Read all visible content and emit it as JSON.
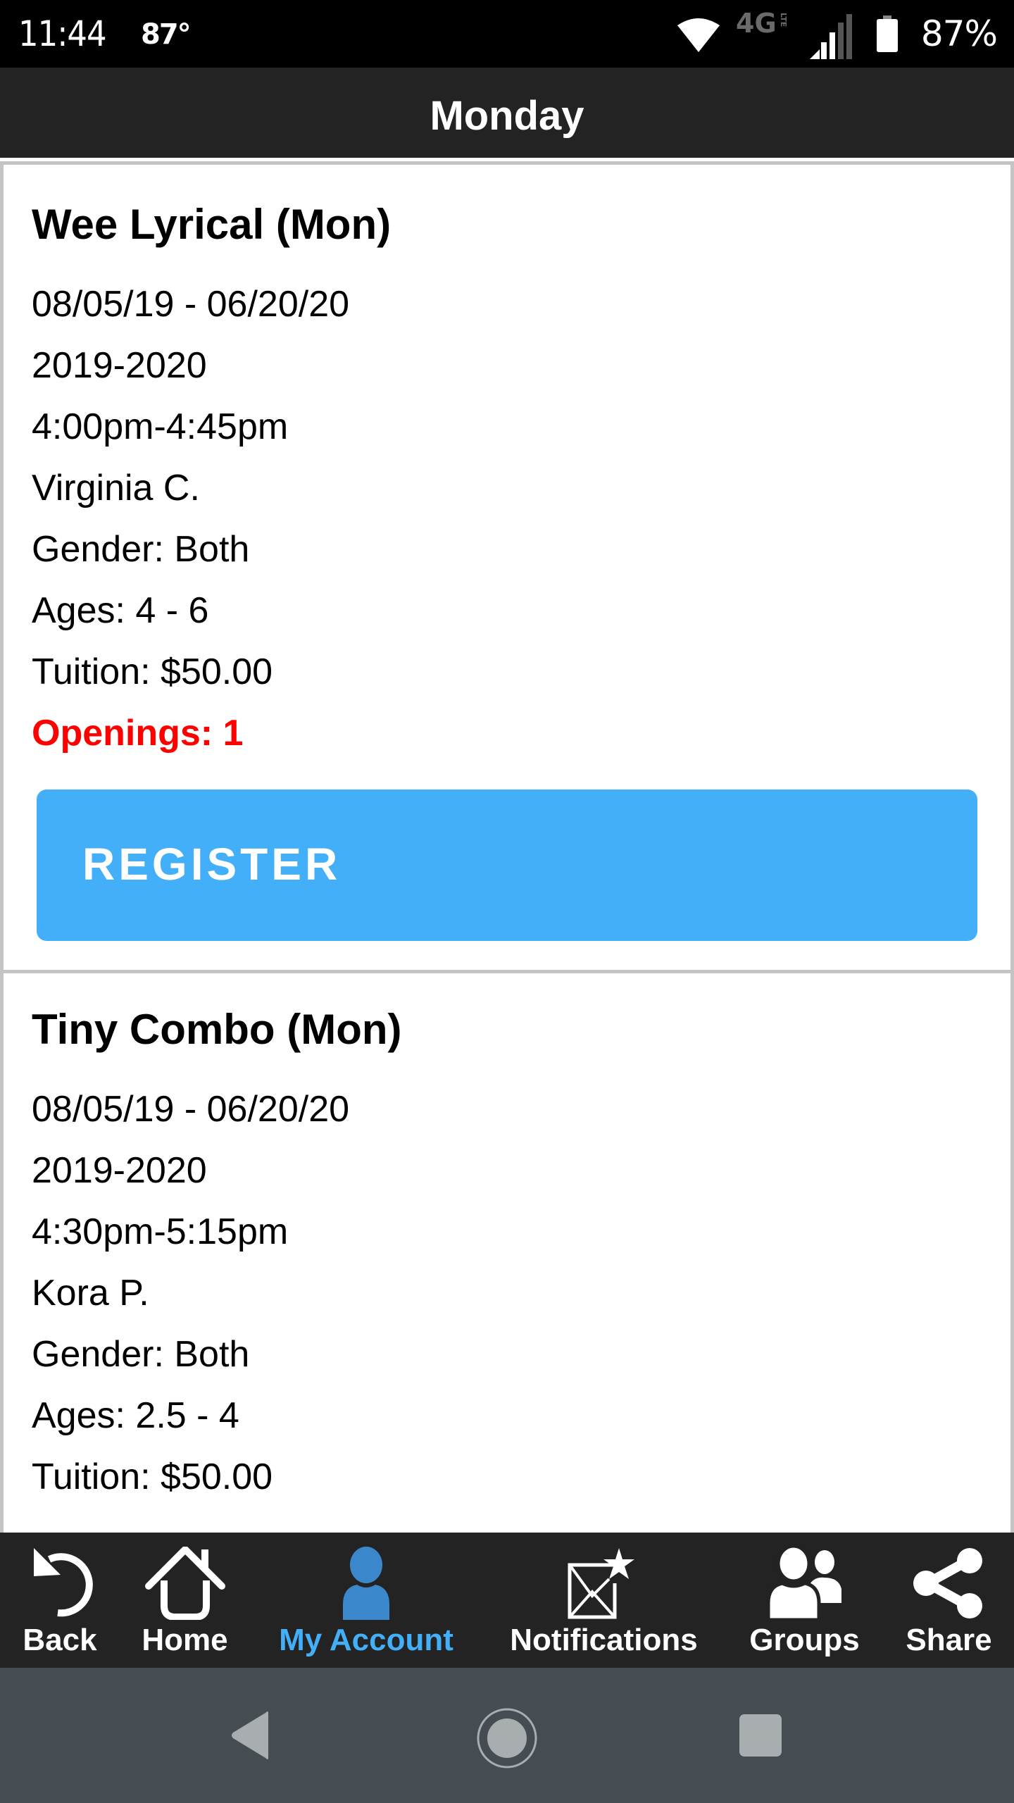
{
  "status_bar": {
    "time": "11:44",
    "temperature": "87°",
    "network": "4G LTE",
    "battery_percent": "87%"
  },
  "header": {
    "title": "Monday"
  },
  "classes": [
    {
      "title": "Wee Lyrical (Mon)",
      "dates": "08/05/19 - 06/20/20",
      "season": "2019-2020",
      "time": "4:00pm-4:45pm",
      "instructor": "Virginia C.",
      "gender": "Gender: Both",
      "ages": "Ages: 4 - 6",
      "tuition": "Tuition: $50.00",
      "openings": "Openings: 1",
      "register_label": "REGISTER"
    },
    {
      "title": "Tiny Combo (Mon)",
      "dates": "08/05/19 - 06/20/20",
      "season": "2019-2020",
      "time": "4:30pm-5:15pm",
      "instructor": "Kora P.",
      "gender": "Gender: Both",
      "ages": "Ages: 2.5 - 4",
      "tuition": "Tuition: $50.00"
    }
  ],
  "bottom_nav": {
    "items": [
      {
        "label": "Back",
        "icon": "back-arrow-icon"
      },
      {
        "label": "Home",
        "icon": "home-icon"
      },
      {
        "label": "My Account",
        "icon": "user-icon",
        "active": true
      },
      {
        "label": "Notifications",
        "icon": "mail-star-icon"
      },
      {
        "label": "Groups",
        "icon": "group-icon"
      },
      {
        "label": "Share",
        "icon": "share-icon"
      }
    ]
  },
  "colors": {
    "accent": "#42aff8",
    "openings_alert": "#ff0000",
    "header_bg": "#232323",
    "system_nav_bg": "#454c52"
  }
}
